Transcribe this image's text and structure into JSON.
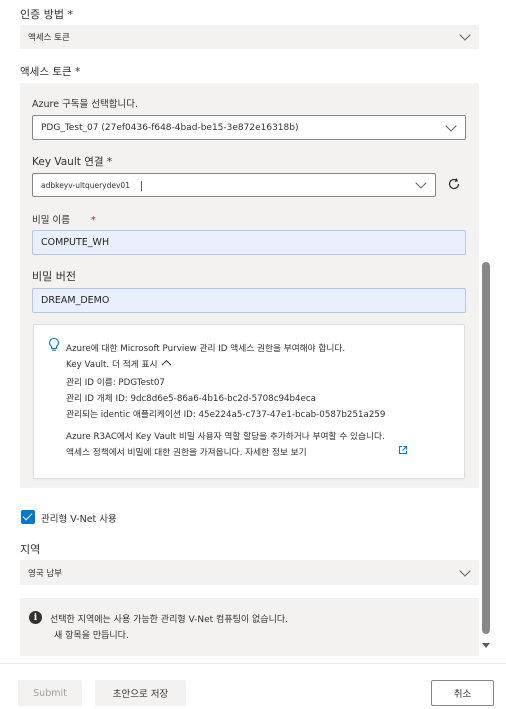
{
  "auth": {
    "method_label": "인증 방법 *",
    "method_value": "액세스 토큰",
    "token_label": "액세스 토큰 *"
  },
  "subscription": {
    "label": "Azure 구독을 선택합니다.",
    "value": "PDG_Test_07 (27ef0436-f648-4bad-be15-3e872e16318b)"
  },
  "keyvault": {
    "label": "Key Vault 연결 *",
    "value": "adbkeyv-ultquerydev01"
  },
  "secret_name": {
    "label": "비밀 이름",
    "required_mark": "*",
    "value": "COMPUTE_WH"
  },
  "secret_version": {
    "label": "비밀 버전",
    "value": "DREAM_DEMO"
  },
  "info": {
    "line1": "Azure에 대한 Microsoft Purview 관리 ID 액세스 권한을 부여해야 합니다.",
    "line2": "Key Vault. 더 적게 표시",
    "line3": "관리 ID 이름: PDGTest07",
    "line4": "관리 ID 개체 ID: 9dc8d6e5-86a6-4b16-bc2d-5708c94b4eca",
    "line5": "관리되는 identic 애플리케이션 ID: 45e224a5-c737-47e1-bcab-0587b251a259",
    "line6": "Azure R3AC에서 Key Vault 비밀 사용자 역할 할당을 추가하거나 부여할 수 있습니다.",
    "line7": "액세스 정책에서 비밀에 대한 권한을 가져옵니다. 자세한 정보 보기"
  },
  "vnet": {
    "checkbox_label": "관리형 V-Net 사용",
    "checked": true
  },
  "region": {
    "label": "지역",
    "value": "영국 남부"
  },
  "warning": {
    "line1": "선택한 지역에는 사용 가능한 관리형 V-Net 컴퓨팅이 없습니다.",
    "line2": "새 항목을 만듭니다."
  },
  "footer": {
    "submit_label": "Submit",
    "draft_label": "초안으로 저장",
    "cancel_label": "취소"
  },
  "colors": {
    "accent": "#0078d4",
    "panel_bg": "#f3f2f1",
    "filled_input": "#e8f0fe"
  }
}
